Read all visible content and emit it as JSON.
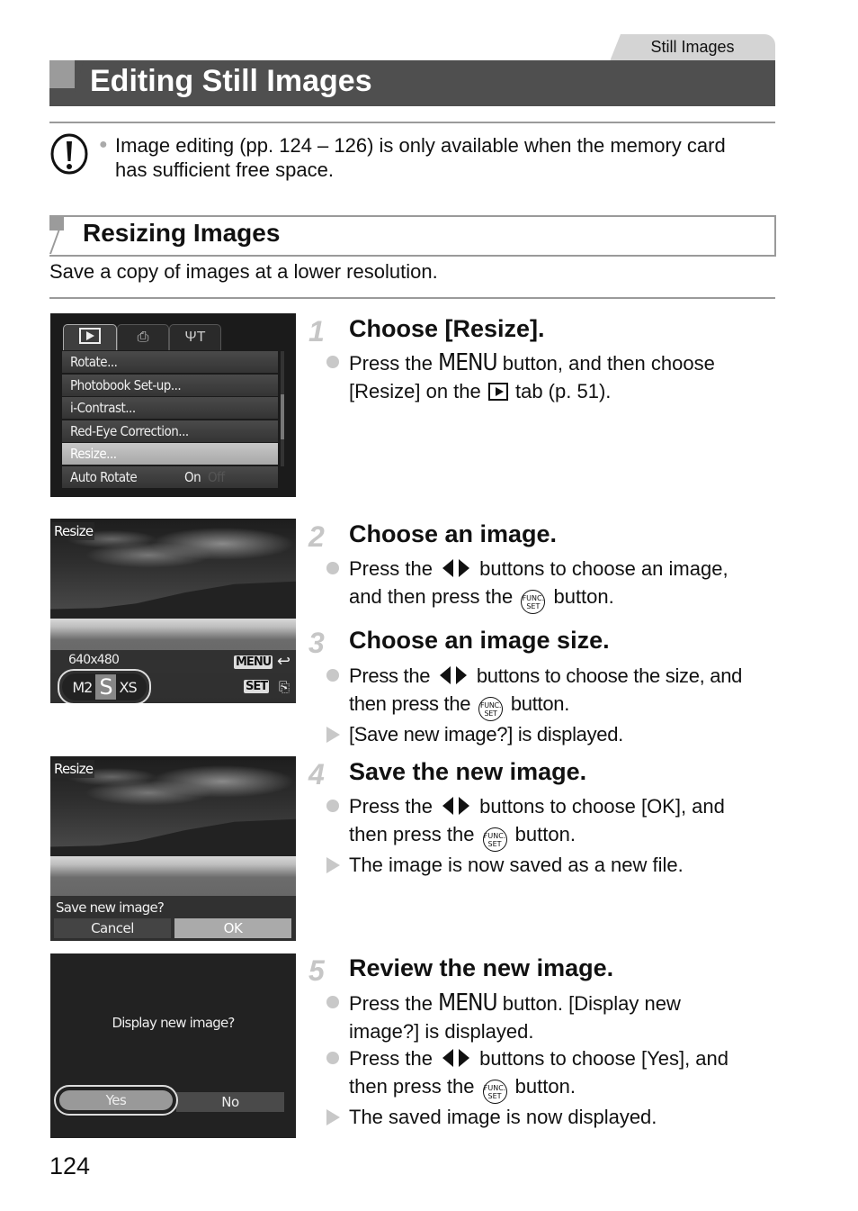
{
  "header": {
    "section_tab": "Still Images",
    "title": "Editing Still Images"
  },
  "caution": {
    "icon": "caution-icon",
    "text": "Image editing (pp. 124 – 126) is only available when the memory card has sufficient free space."
  },
  "subsection": {
    "title": "Resizing Images",
    "intro": "Save a copy of images at a lower resolution."
  },
  "screens": {
    "menu": {
      "tabs": [
        "play-tab-icon",
        "print-tab-icon",
        "tools-tab-icon"
      ],
      "items": [
        "Rotate...",
        "Photobook Set-up...",
        "i-Contrast...",
        "Red-Eye Correction...",
        "Resize...",
        "Auto Rotate"
      ],
      "selected": "Resize...",
      "auto_rotate_on": "On",
      "auto_rotate_off": "Off"
    },
    "resize": {
      "label": "Resize",
      "resolution": "640x480",
      "sizes": [
        "M2",
        "S",
        "XS"
      ],
      "selected_size": "S",
      "menu_key": "MENU",
      "set_key": "SET"
    },
    "save": {
      "label": "Resize",
      "prompt": "Save new image?",
      "cancel": "Cancel",
      "ok": "OK"
    },
    "display": {
      "prompt": "Display new image?",
      "yes": "Yes",
      "no": "No"
    }
  },
  "steps": [
    {
      "num": "1",
      "title": "Choose [Resize].",
      "l1a": "Press the ",
      "menu": "MENU",
      "l1b": " button, and then choose",
      "l2a": "[Resize] on the ",
      "l2b": " tab (p. 51)."
    },
    {
      "num": "2",
      "title": "Choose an image.",
      "l1a": "Press the ",
      "l1b": " buttons to choose an image,",
      "l2a": "and then press the ",
      "l2b": " button."
    },
    {
      "num": "3",
      "title": "Choose an image size.",
      "l1a": "Press the ",
      "l1b": " buttons to choose the size, and",
      "l2a": "then press the ",
      "l2b": " button.",
      "result": "[Save new image?] is displayed."
    },
    {
      "num": "4",
      "title": "Save the new image.",
      "l1a": "Press the ",
      "l1b": " buttons to choose [OK], and",
      "l2a": "then press the ",
      "l2b": " button.",
      "result": "The image is now saved as a new file."
    },
    {
      "num": "5",
      "title": "Review the new image.",
      "l1a": "Press the ",
      "menu": "MENU",
      "l1b": " button. [Display new",
      "l2": "image?] is displayed.",
      "l3a": "Press the ",
      "l3b": " buttons to choose [Yes], and",
      "l4a": "then press the ",
      "l4b": " button.",
      "result": "The saved image is now displayed."
    }
  ],
  "func_label_top": "FUNC.",
  "func_label_bottom": "SET",
  "page_number": "124"
}
